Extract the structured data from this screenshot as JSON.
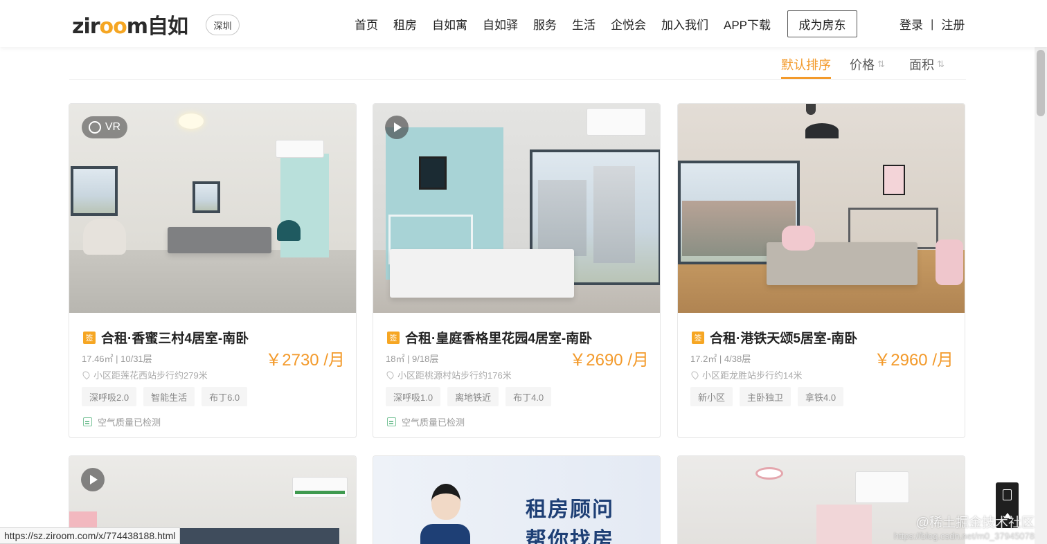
{
  "header": {
    "logo_text_1": "zir",
    "logo_text_oo": "oo",
    "logo_text_2": "m",
    "logo_text_cn": "自如",
    "city": "深圳",
    "nav": [
      "首页",
      "租房",
      "自如寓",
      "自如驿",
      "服务",
      "生活",
      "企悦会",
      "加入我们",
      "APP下载"
    ],
    "landlord_button": "成为房东",
    "login": "登录",
    "separator": "|",
    "register": "注册"
  },
  "sortbar": {
    "default": "默认排序",
    "price": "价格",
    "area": "面积",
    "arrow": "⇅"
  },
  "listings": [
    {
      "badge": "VR",
      "sign": "签",
      "title": "合租·香蜜三村4居室-南卧",
      "meta": "17.46㎡ | 10/31层",
      "price": "￥2730 /月",
      "location": "小区距莲花西站步行约279米",
      "tags": [
        "深呼吸2.0",
        "智能生活",
        "布丁6.0"
      ],
      "air": "空气质量已检测"
    },
    {
      "badge": "play",
      "sign": "签",
      "title": "合租·皇庭香格里花园4居室-南卧",
      "meta": "18㎡ | 9/18层",
      "price": "￥2690 /月",
      "location": "小区距桃源村站步行约176米",
      "tags": [
        "深呼吸1.0",
        "离地铁近",
        "布丁4.0"
      ],
      "air": "空气质量已检测"
    },
    {
      "badge": "",
      "sign": "签",
      "title": "合租·港铁天颂5居室-南卧",
      "meta": "17.2㎡ | 4/38层",
      "price": "￥2960 /月",
      "location": "小区距龙胜站步行约14米",
      "tags": [
        "新小区",
        "主卧独卫",
        "拿铁4.0"
      ],
      "air": ""
    }
  ],
  "promo": {
    "line1": "租房顾问",
    "line2": "帮你找房"
  },
  "status_url": "https://sz.ziroom.com/x/774438188.html",
  "watermark": {
    "line1": "@稀土掘金技术社区",
    "line2": "https://blog.csdn.net/m0_37945078"
  },
  "colors": {
    "accent": "#f39a2b",
    "promo_text": "#1e3f75"
  }
}
